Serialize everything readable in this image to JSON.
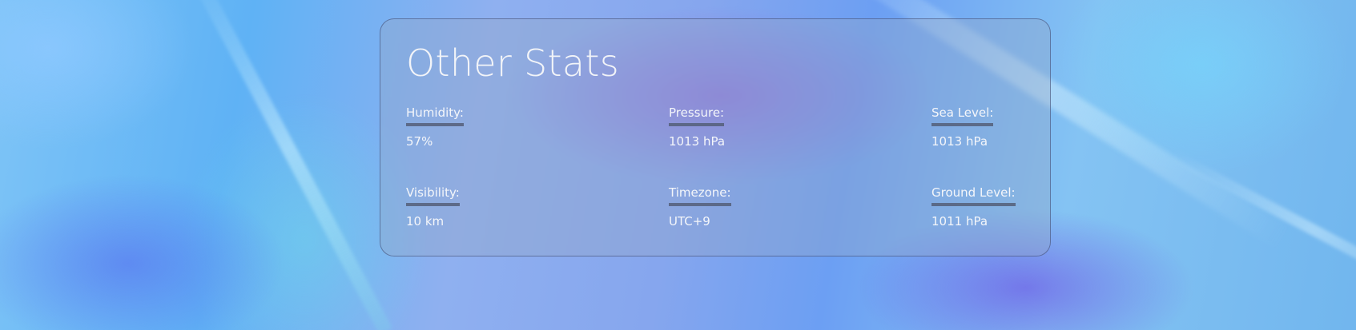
{
  "card": {
    "title": "Other Stats",
    "stats": [
      {
        "label": "Humidity:",
        "value": "57%"
      },
      {
        "label": "Pressure:",
        "value": "1013 hPa"
      },
      {
        "label": "Sea Level:",
        "value": "1013 hPa"
      },
      {
        "label": "Visibility:",
        "value": "10 km"
      },
      {
        "label": "Timezone:",
        "value": "UTC+9"
      },
      {
        "label": "Ground Level:",
        "value": "1011 hPa"
      }
    ]
  },
  "colors": {
    "card_border": "#3c466e",
    "text": "#f4f6fa",
    "underline": "#555f78"
  }
}
